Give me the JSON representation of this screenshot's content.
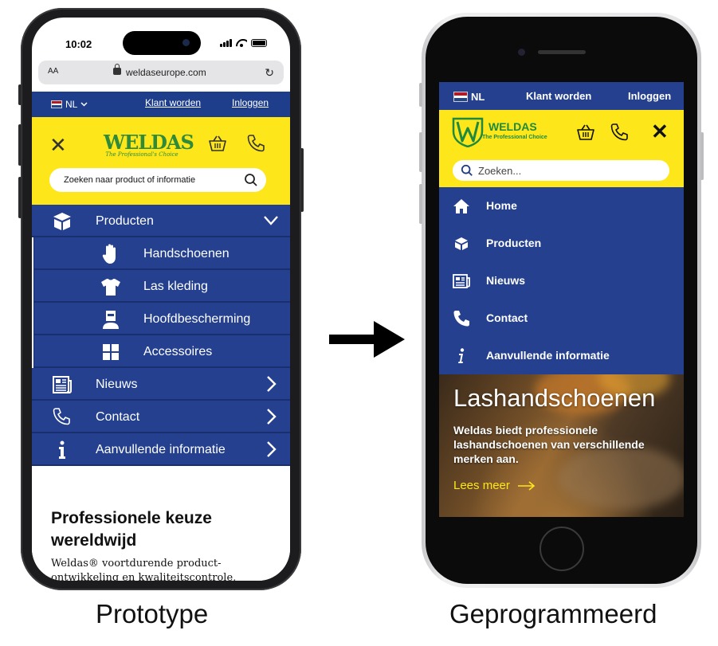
{
  "prototype": {
    "status": {
      "time": "10:02"
    },
    "browser": {
      "text_size_label": "AA",
      "url": "weldaseurope.com"
    },
    "topbar": {
      "language": "NL",
      "customer_link": "Klant worden",
      "login_link": "Inloggen"
    },
    "logo": {
      "name": "WELDAS",
      "tagline": "The Professional's Choice"
    },
    "search": {
      "placeholder": "Zoeken naar product of informatie"
    },
    "menu": [
      {
        "label": "Producten",
        "icon": "box-icon",
        "state": "expanded"
      },
      {
        "label": "Handschoenen",
        "icon": "glove-icon",
        "sub": true
      },
      {
        "label": "Las kleding",
        "icon": "shirt-icon",
        "sub": true
      },
      {
        "label": "Hoofdbescherming",
        "icon": "welding-helmet-icon",
        "sub": true
      },
      {
        "label": "Accessoires",
        "icon": "grid-icon",
        "sub": true
      },
      {
        "label": "Nieuws",
        "icon": "newspaper-icon"
      },
      {
        "label": "Contact",
        "icon": "phone-icon"
      },
      {
        "label": "Aanvullende informatie",
        "icon": "info-icon"
      }
    ],
    "content": {
      "heading": "Professionele keuze wereldwijd",
      "body": "Weldas® voortdurende product-ontwikkeling en kwaliteitscontrole,"
    }
  },
  "programmed": {
    "topbar": {
      "language": "NL",
      "customer_link": "Klant worden",
      "login_link": "Inloggen"
    },
    "logo": {
      "name": "WELDAS",
      "tagline": "The Professional Choice"
    },
    "search": {
      "placeholder": "Zoeken..."
    },
    "menu": [
      {
        "label": "Home",
        "icon": "home-icon"
      },
      {
        "label": "Producten",
        "icon": "box-icon"
      },
      {
        "label": "Nieuws",
        "icon": "newspaper-icon"
      },
      {
        "label": "Contact",
        "icon": "phone-icon"
      },
      {
        "label": "Aanvullende informatie",
        "icon": "info-icon"
      }
    ],
    "hero": {
      "title": "Lashandschoenen",
      "text": "Weldas biedt professionele lashandschoenen van verschillende merken aan.",
      "cta": "Lees meer"
    }
  },
  "captions": {
    "left": "Prototype",
    "right": "Geprogrammeerd"
  },
  "colors": {
    "brand_blue": "#24408e",
    "brand_yellow": "#fde61a",
    "logo_green": "#2f8a3a"
  }
}
